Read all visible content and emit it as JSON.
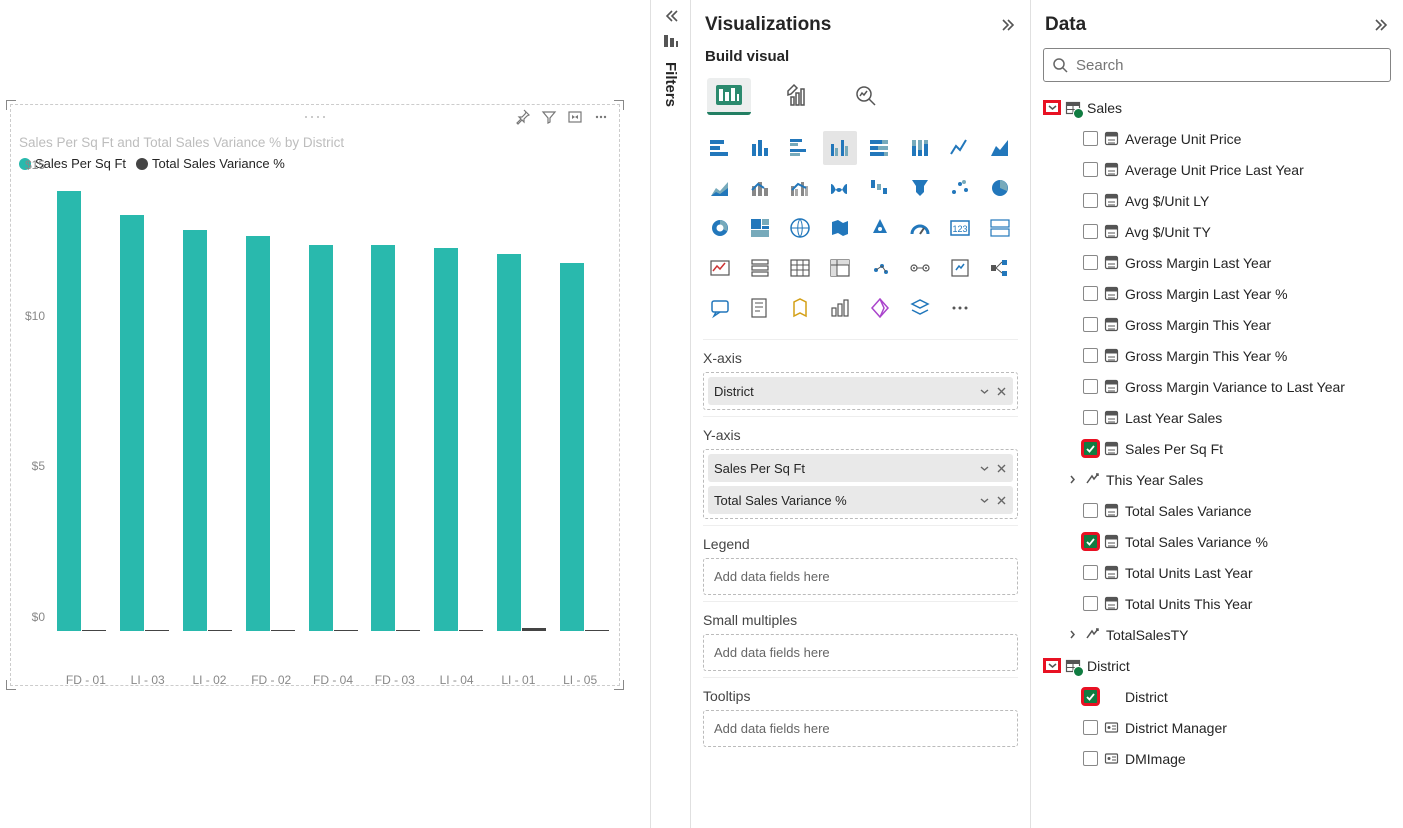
{
  "chart_data": {
    "type": "bar",
    "title": "Sales Per Sq Ft and Total Sales Variance % by District",
    "ylabel": "",
    "xlabel": "",
    "ylim": [
      0,
      15
    ],
    "y_ticks": [
      "$0",
      "$5",
      "$10",
      "$15"
    ],
    "categories": [
      "FD - 01",
      "LI - 03",
      "LI - 02",
      "FD - 02",
      "FD - 04",
      "FD - 03",
      "LI - 04",
      "LI - 01",
      "LI - 05"
    ],
    "series": [
      {
        "name": "Sales Per Sq Ft",
        "color": "#29b9ad",
        "values": [
          14.6,
          13.8,
          13.3,
          13.1,
          12.8,
          12.8,
          12.7,
          12.5,
          12.2
        ]
      },
      {
        "name": "Total Sales Variance %",
        "color": "#444444",
        "values": [
          0.05,
          0.05,
          0.05,
          0.05,
          0.05,
          0.05,
          0.05,
          0.1,
          0.05
        ]
      }
    ]
  },
  "filters_label": "Filters",
  "viz_panel": {
    "title": "Visualizations",
    "subtitle": "Build visual",
    "wells": [
      {
        "label": "X-axis",
        "chips": [
          "District"
        ]
      },
      {
        "label": "Y-axis",
        "chips": [
          "Sales Per Sq Ft",
          "Total Sales Variance %"
        ]
      },
      {
        "label": "Legend",
        "chips": [],
        "placeholder": "Add data fields here"
      },
      {
        "label": "Small multiples",
        "chips": [],
        "placeholder": "Add data fields here"
      },
      {
        "label": "Tooltips",
        "chips": [],
        "placeholder": "Add data fields here"
      }
    ]
  },
  "data_panel": {
    "title": "Data",
    "search_placeholder": "Search",
    "tables": [
      {
        "name": "Sales",
        "highlighted": true,
        "fields": [
          {
            "name": "Average Unit Price",
            "type": "calc",
            "checked": false
          },
          {
            "name": "Average Unit Price Last Year",
            "type": "calc",
            "checked": false
          },
          {
            "name": "Avg $/Unit LY",
            "type": "calc",
            "checked": false
          },
          {
            "name": "Avg $/Unit TY",
            "type": "calc",
            "checked": false
          },
          {
            "name": "Gross Margin Last Year",
            "type": "calc",
            "checked": false
          },
          {
            "name": "Gross Margin Last Year %",
            "type": "calc",
            "checked": false
          },
          {
            "name": "Gross Margin This Year",
            "type": "calc",
            "checked": false
          },
          {
            "name": "Gross Margin This Year %",
            "type": "calc",
            "checked": false
          },
          {
            "name": "Gross Margin Variance to Last Year",
            "type": "calc",
            "checked": false
          },
          {
            "name": "Last Year Sales",
            "type": "calc",
            "checked": false
          },
          {
            "name": "Sales Per Sq Ft",
            "type": "calc",
            "checked": true,
            "highlighted": true
          },
          {
            "name": "This Year Sales",
            "type": "hierarchy",
            "checked": false,
            "expandable": true
          },
          {
            "name": "Total Sales Variance",
            "type": "calc",
            "checked": false
          },
          {
            "name": "Total Sales Variance %",
            "type": "calc",
            "checked": true,
            "highlighted": true
          },
          {
            "name": "Total Units Last Year",
            "type": "calc",
            "checked": false
          },
          {
            "name": "Total Units This Year",
            "type": "calc",
            "checked": false
          },
          {
            "name": "TotalSalesTY",
            "type": "hierarchy",
            "checked": false,
            "expandable": true
          }
        ]
      },
      {
        "name": "District",
        "highlighted": true,
        "fields": [
          {
            "name": "District",
            "type": "blank",
            "checked": true,
            "highlighted": true
          },
          {
            "name": "District Manager",
            "type": "identity",
            "checked": false
          },
          {
            "name": "DMImage",
            "type": "identity",
            "checked": false
          }
        ]
      }
    ]
  }
}
